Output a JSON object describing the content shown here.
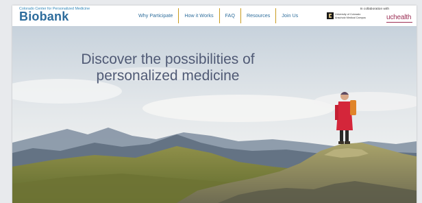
{
  "brand": {
    "subtitle": "Colorado Center for Personalized Medicine",
    "name": "Biobank"
  },
  "nav": {
    "items": [
      {
        "label": "Why Participate"
      },
      {
        "label": "How it Works"
      },
      {
        "label": "FAQ"
      },
      {
        "label": "Resources"
      },
      {
        "label": "Join Us"
      }
    ]
  },
  "partners": {
    "collaboration_text": "In collaboration with",
    "cu_line1": "University of Colorado",
    "cu_line2": "Anschutz Medical Campus",
    "uchealth": "uchealth"
  },
  "hero": {
    "headline_line1": "Discover the possibilities of",
    "headline_line2": "personalized medicine"
  },
  "colors": {
    "brand_blue": "#2d6c9c",
    "nav_separator": "#c89a1c",
    "uchealth": "#9c2f55",
    "headline": "#505a75"
  }
}
